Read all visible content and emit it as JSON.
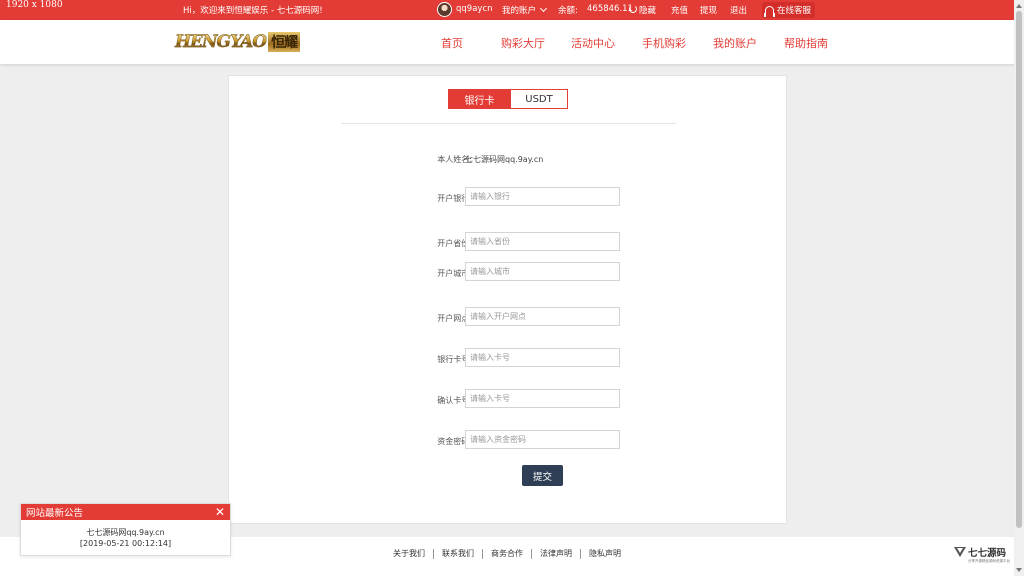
{
  "screen": {
    "resolution_label": "1920 x 1080"
  },
  "topbar": {
    "welcome": "Hi，欢迎来到恒耀娱乐 - 七七源码网!",
    "username": "qq9aycn",
    "my_account": "我的账户",
    "balance_label": "余额:",
    "balance_value": "465846.11",
    "hide_label": "隐藏",
    "recharge": "充值",
    "withdraw": "提现",
    "logout": "退出",
    "online_service": "在线客服"
  },
  "header": {
    "logo_text": "HENGYAO",
    "logo_box_text": "恒耀",
    "nav": [
      "首页",
      "购彩大厅",
      "活动中心",
      "手机购彩",
      "我的账户",
      "帮助指南"
    ]
  },
  "tabs": {
    "bank_card": "银行卡",
    "usdt": "USDT"
  },
  "form": {
    "name_label": "本人姓名:",
    "name_value": "七七源码网qq.9ay.cn",
    "bank_label": "开户银行:",
    "bank_placeholder": "请输入银行",
    "province_label": "开户省份:",
    "province_placeholder": "请输入省份",
    "city_label": "开户城市:",
    "city_placeholder": "请输入城市",
    "branch_label": "开户网点:",
    "branch_placeholder": "请输入开户网点",
    "card_label": "银行卡号:",
    "card_placeholder": "请输入卡号",
    "confirm_label": "确认卡号:",
    "confirm_placeholder": "请输入卡号",
    "password_label": "资金密码:",
    "password_placeholder": "请输入资金密码",
    "submit": "提交"
  },
  "notice": {
    "title": "网站最新公告",
    "line1": "七七源码网qq.9ay.cn",
    "line2": "[2019-05-21 00:12:14]"
  },
  "footer": {
    "links": [
      "关于我们",
      "联系我们",
      "商务合作",
      "法律声明",
      "隐私声明"
    ],
    "brand_name": "七七源码",
    "brand_sub": "分享开源精品源码资源平台"
  },
  "colors": {
    "primary_red": "#e33b35",
    "submit_navy": "#2e3f55"
  }
}
